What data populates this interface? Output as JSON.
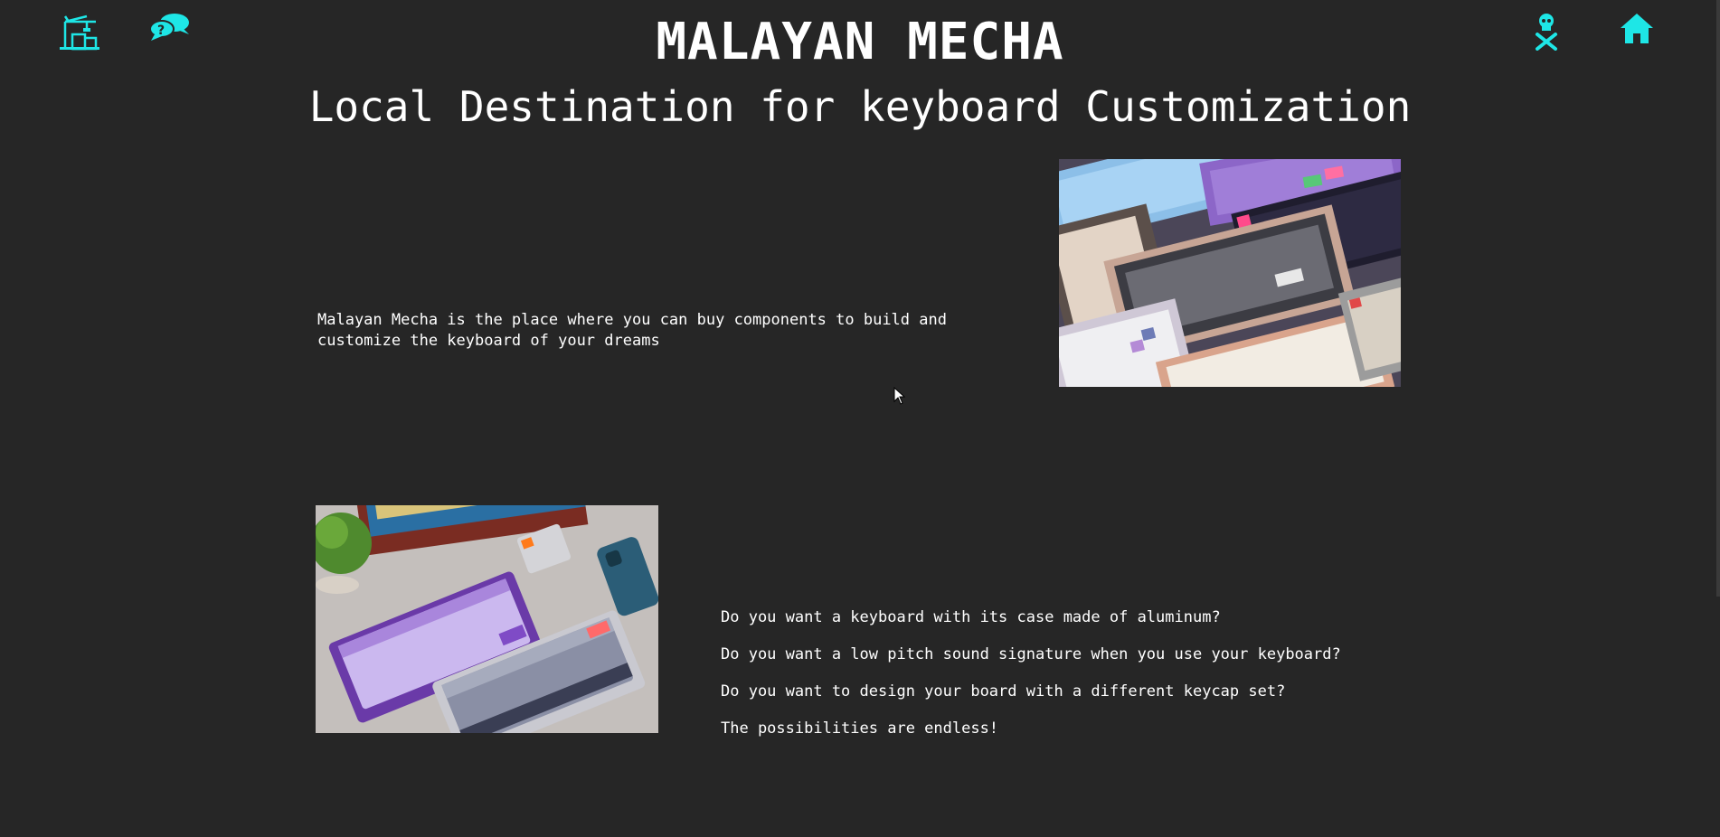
{
  "header": {
    "title": "MALAYAN MECHA",
    "subtitle": "Local Destination for keyboard Customization",
    "icons": {
      "left_1": "crane-icon",
      "left_2": "chat-icon",
      "right_1": "skull-crossbones-icon",
      "right_2": "home-icon"
    },
    "icon_color": "#1ee6e6"
  },
  "intro": {
    "text": "Malayan Mecha is the place where you can buy components to build and customize the keyboard of your dreams"
  },
  "images": {
    "top_right": "keyboards-grid-photo",
    "bottom_left": "keyboards-desk-photo"
  },
  "questions": [
    "Do you want a keyboard with its case made of aluminum?",
    "Do you want a low pitch sound signature when you use your keyboard?",
    "Do you want to design your board with a different keycap set?",
    "The possibilities are endless!"
  ],
  "colors": {
    "background": "#262626",
    "text": "#ffffff",
    "accent": "#1ee6e6"
  }
}
